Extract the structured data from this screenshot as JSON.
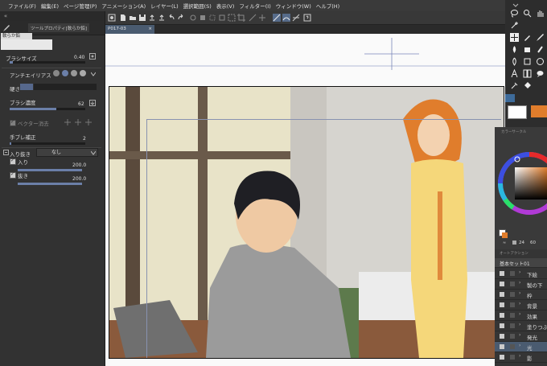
{
  "menu": [
    "ファイル(F)",
    "編集(E)",
    "ページ管理(P)",
    "アニメーション(A)",
    "レイヤー(L)",
    "選択範囲(S)",
    "表示(V)",
    "フィルター(I)",
    "ウィンドウ(W)",
    "ヘルプ(H)"
  ],
  "left_panel": {
    "collapse_arrows": "«",
    "tab_label": "ツールプロパティ[軟らか鉛]",
    "brush_name": "軟らか鉛",
    "brush_size_label": "ブラシサイズ",
    "brush_size_value": "0.40",
    "antialias_label": "アンチエイリアス",
    "hardness_label": "硬さ",
    "density_label": "ブラシ濃度",
    "density_value": "62",
    "vector_erase_label": "ベクター消去",
    "stabilization_label": "手ブレ補正",
    "stabilization_value": "2",
    "taper_label": "入り抜き",
    "taper_select": "なし",
    "taper_in_label": "入り",
    "taper_in_value": "200.0",
    "taper_out_label": "抜き",
    "taper_out_value": "200.0"
  },
  "document_tab": "P017-03",
  "color_panel": {
    "title": "カラーサークル",
    "value": "24",
    "value2": "60"
  },
  "layers_panel": {
    "title": "オートアクション",
    "set_name": "基本セット01",
    "items": [
      "下絵",
      "製の下",
      "枠",
      "背景",
      "効果",
      "塗りつぶ",
      "発光",
      "光",
      "影"
    ]
  },
  "colors": {
    "accent": "#e07d2c",
    "selection": "#4a5b70"
  }
}
